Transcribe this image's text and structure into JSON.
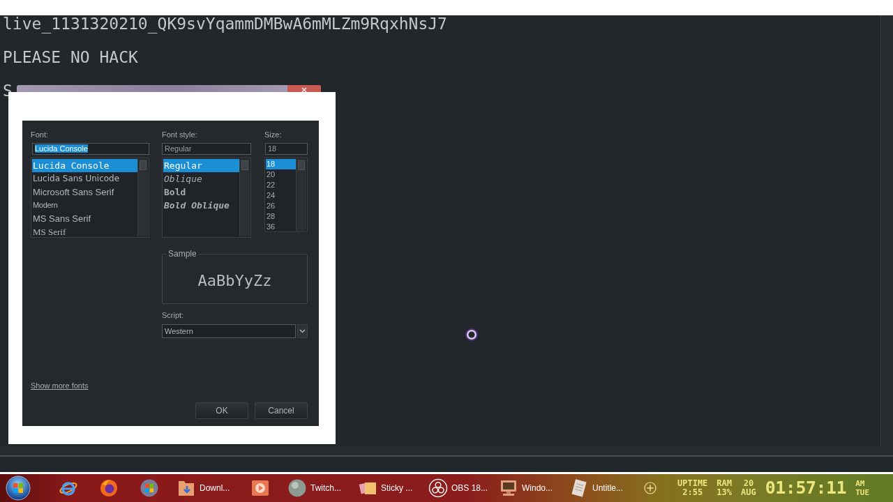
{
  "editor": {
    "lines": [
      "live_1131320210_QK9svYqammDMBwA6mMLZm9RqxhNsJ7",
      "PLEASE NO HACK",
      "S"
    ]
  },
  "font_dialog": {
    "font": {
      "label": "Font:",
      "value": "Lucida Console",
      "value_selected": true,
      "items": [
        {
          "label": "Lucida Console",
          "kind": "mono",
          "selected": true
        },
        {
          "label": "Lucida Sans Unicode",
          "kind": "humanist",
          "selected": false
        },
        {
          "label": "Microsoft Sans Serif",
          "kind": "sans",
          "selected": false
        },
        {
          "label": "Modern",
          "kind": "narrow",
          "selected": false
        },
        {
          "label": "MS Sans Serif",
          "kind": "sans",
          "selected": false
        },
        {
          "label": "MS Serif",
          "kind": "serif",
          "selected": false
        }
      ]
    },
    "style": {
      "label": "Font style:",
      "value": "Regular",
      "items": [
        {
          "label": "Regular",
          "kind": "regular",
          "selected": true
        },
        {
          "label": "Oblique",
          "kind": "oblique",
          "selected": false
        },
        {
          "label": "Bold",
          "kind": "bold",
          "selected": false
        },
        {
          "label": "Bold Oblique",
          "kind": "bold_oblique",
          "selected": false
        }
      ]
    },
    "size": {
      "label": "Size:",
      "value": "18",
      "items": [
        {
          "label": "18",
          "selected": true
        },
        {
          "label": "20",
          "selected": false
        },
        {
          "label": "22",
          "selected": false
        },
        {
          "label": "24",
          "selected": false
        },
        {
          "label": "26",
          "selected": false
        },
        {
          "label": "28",
          "selected": false
        },
        {
          "label": "36",
          "selected": false
        }
      ]
    },
    "sample": {
      "label": "Sample",
      "text": "AaBbYyZz"
    },
    "script": {
      "label": "Script:",
      "value": "Western"
    },
    "link": "Show more fonts",
    "buttons": [
      "OK",
      "Cancel"
    ]
  },
  "taskbar": {
    "items": [
      {
        "kind": "orbit"
      },
      {
        "kind": "flame"
      },
      {
        "kind": "flag-orb"
      },
      {
        "kind": "folder",
        "label": "Downl..."
      },
      {
        "kind": "play"
      },
      {
        "kind": "sphere",
        "label": "Twitch..."
      },
      {
        "kind": "notes",
        "label": "Sticky ..."
      },
      {
        "kind": "ring",
        "label": "OBS 18..."
      },
      {
        "kind": "monitor",
        "label": "Windo..."
      },
      {
        "kind": "notepad",
        "label": "Untitle..."
      }
    ],
    "clock": {
      "uptime_label": "UPTIME",
      "uptime": "2:55",
      "ram_label": "RAM",
      "ram": "13%",
      "day": "20",
      "month": "AUG",
      "time": "01:57:11",
      "ampm": "AM",
      "weekday": "TUE"
    }
  }
}
